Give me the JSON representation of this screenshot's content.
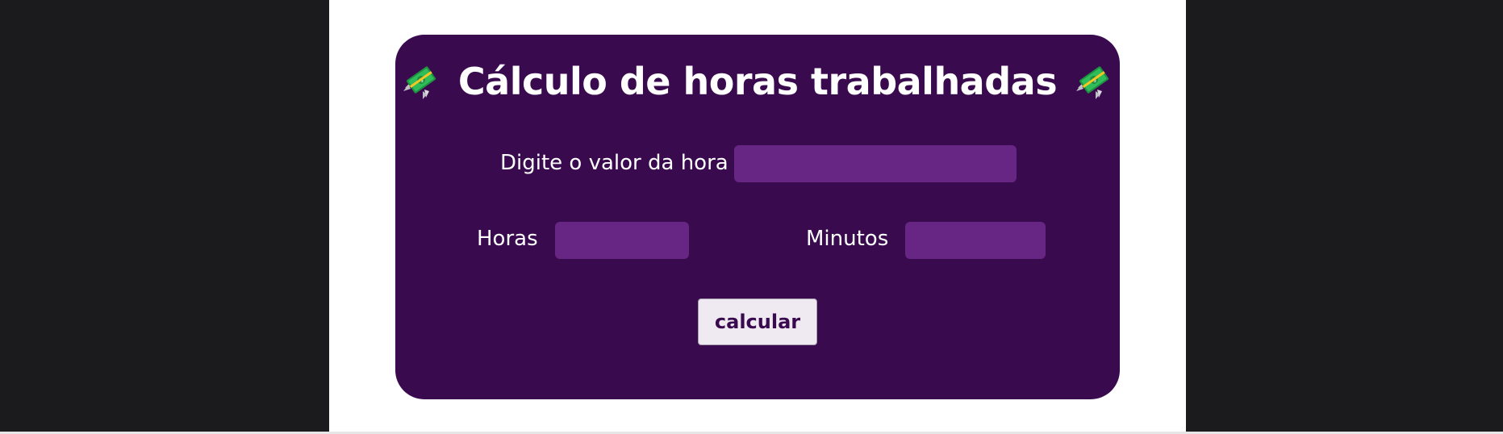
{
  "header": {
    "title": "Cálculo de horas trabalhadas",
    "left_icon": "money-with-wings-icon",
    "right_icon": "money-with-wings-icon"
  },
  "form": {
    "valor_hora": {
      "label": "Digite o valor da hora",
      "value": ""
    },
    "horas": {
      "label": "Horas",
      "value": ""
    },
    "minutos": {
      "label": "Minutos",
      "value": ""
    },
    "submit_label": "calcular"
  },
  "colors": {
    "background": "#1b1b1d",
    "page": "#ffffff",
    "card": "#3a0a4f",
    "input": "#672683",
    "button": "#efeaf1",
    "button_text": "#3a0a4f"
  }
}
